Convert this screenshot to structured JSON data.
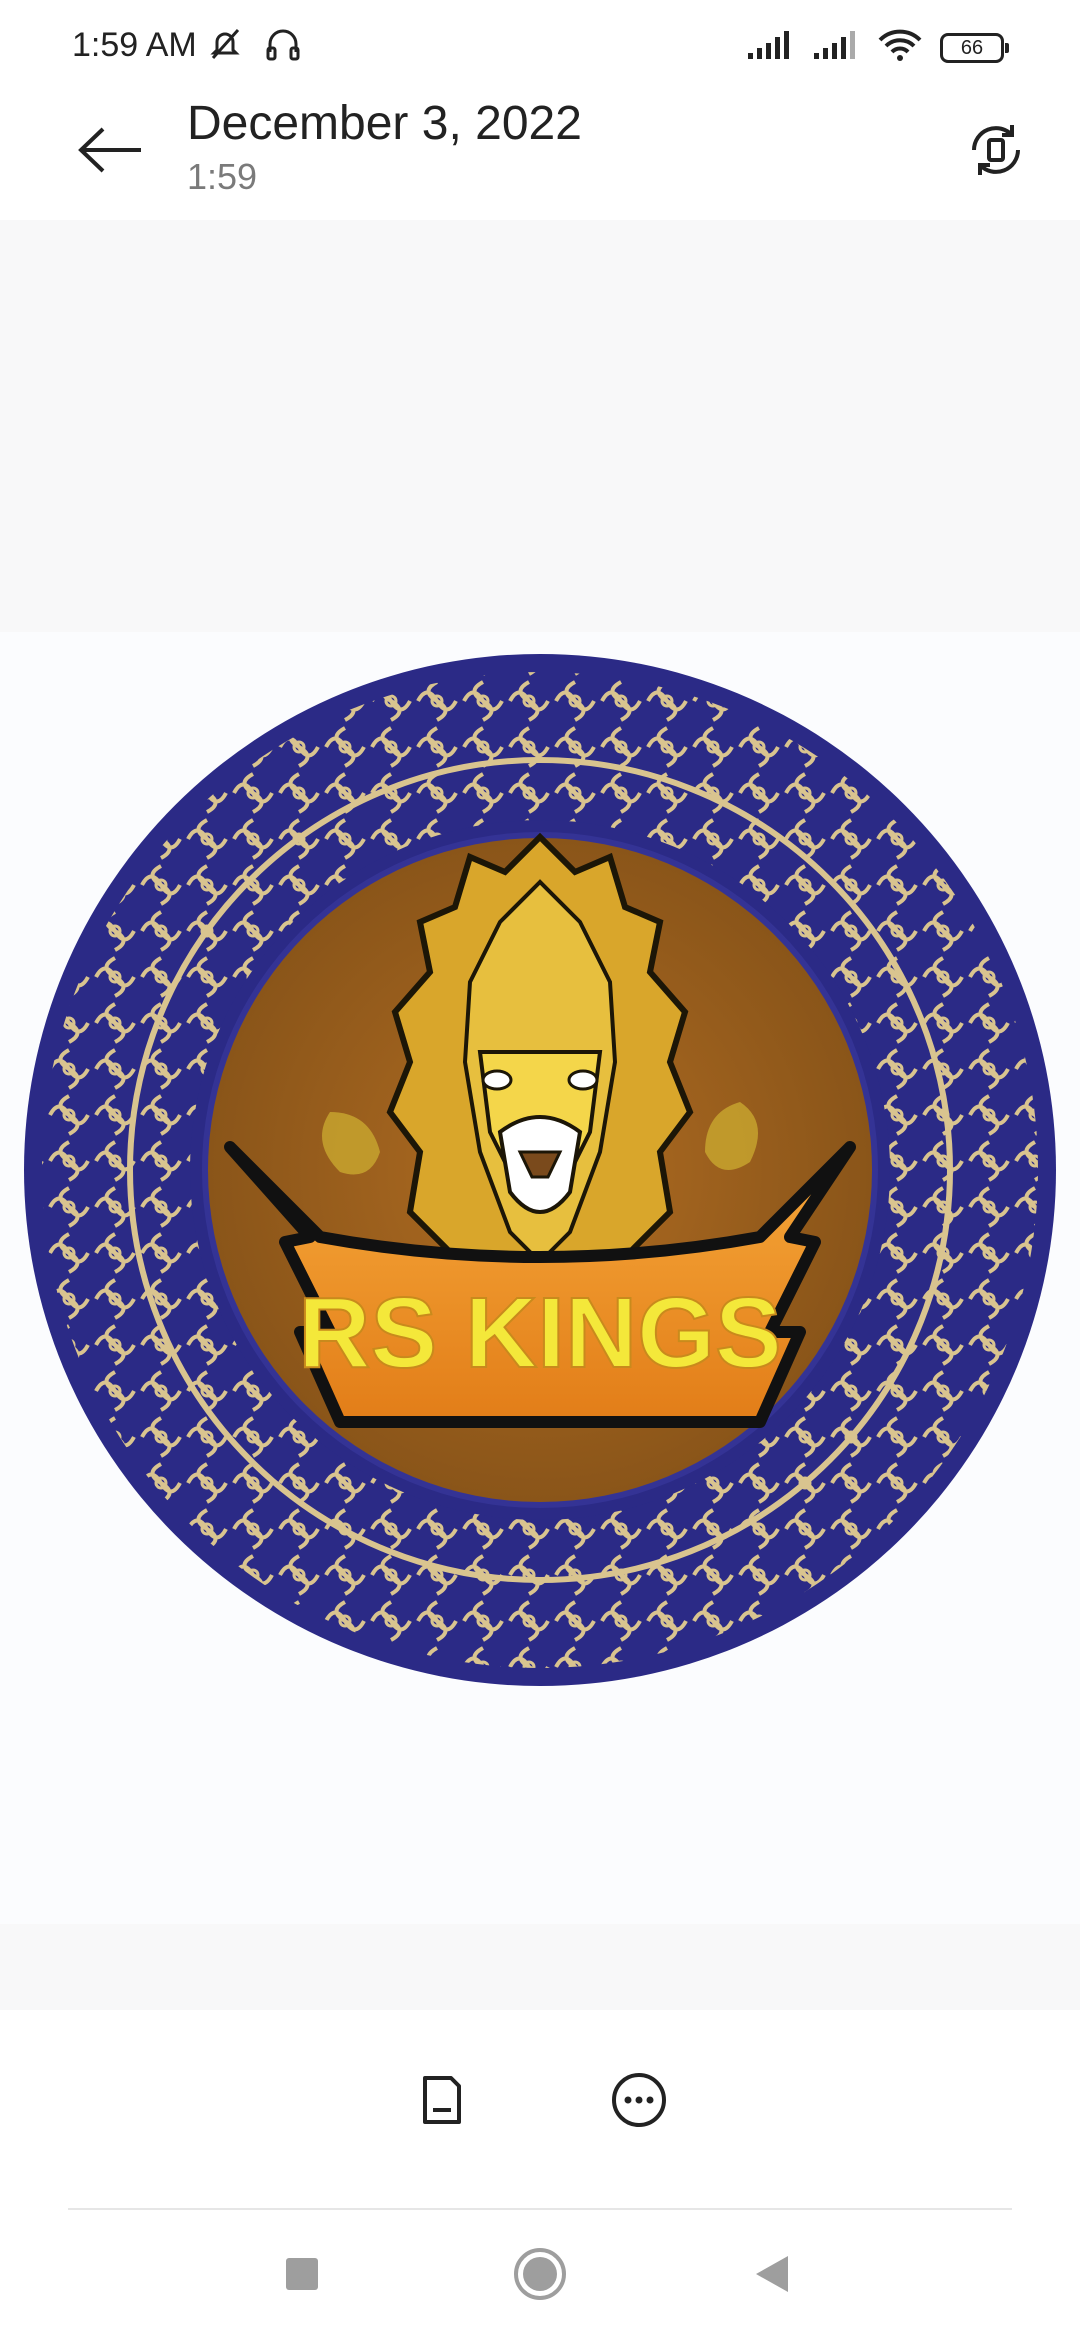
{
  "status_bar": {
    "time": "1:59 AM",
    "battery": "66",
    "icons": [
      "mute-icon",
      "headphones-icon",
      "signal-icon",
      "signal-icon",
      "wifi-icon",
      "battery-icon"
    ]
  },
  "header": {
    "title": "December 3, 2022",
    "subtitle": "1:59",
    "back_icon": "back-arrow-icon",
    "rotate_icon": "rotate-icon"
  },
  "image": {
    "logo_text": "RS KINGS",
    "colors": {
      "ring_blue": "#2b2a86",
      "ornament_gold": "#d9c48f",
      "inner_brown": "#9a5e1f",
      "banner_orange": "#ec8f24",
      "banner_text": "#f4e83a"
    }
  },
  "bottom_actions": {
    "icons": [
      "document-icon",
      "more-icon"
    ]
  },
  "nav_bar": {
    "icons": [
      "recents-icon",
      "home-icon",
      "back-icon"
    ]
  }
}
